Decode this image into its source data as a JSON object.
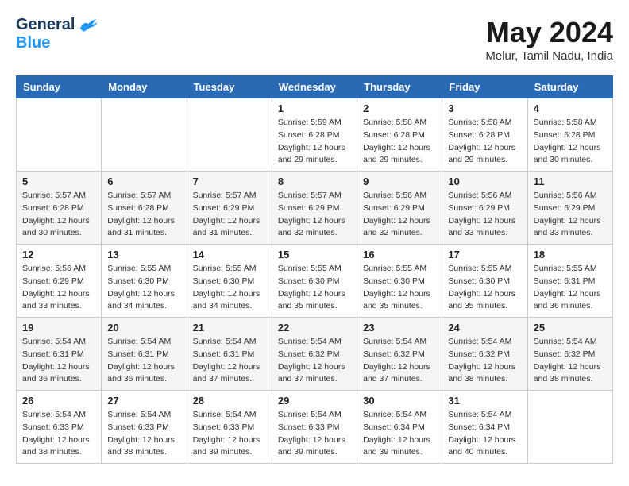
{
  "header": {
    "logo_general": "General",
    "logo_blue": "Blue",
    "month_title": "May 2024",
    "location": "Melur, Tamil Nadu, India"
  },
  "days_of_week": [
    "Sunday",
    "Monday",
    "Tuesday",
    "Wednesday",
    "Thursday",
    "Friday",
    "Saturday"
  ],
  "weeks": [
    [
      {
        "day": "",
        "info": ""
      },
      {
        "day": "",
        "info": ""
      },
      {
        "day": "",
        "info": ""
      },
      {
        "day": "1",
        "info": "Sunrise: 5:59 AM\nSunset: 6:28 PM\nDaylight: 12 hours\nand 29 minutes."
      },
      {
        "day": "2",
        "info": "Sunrise: 5:58 AM\nSunset: 6:28 PM\nDaylight: 12 hours\nand 29 minutes."
      },
      {
        "day": "3",
        "info": "Sunrise: 5:58 AM\nSunset: 6:28 PM\nDaylight: 12 hours\nand 29 minutes."
      },
      {
        "day": "4",
        "info": "Sunrise: 5:58 AM\nSunset: 6:28 PM\nDaylight: 12 hours\nand 30 minutes."
      }
    ],
    [
      {
        "day": "5",
        "info": "Sunrise: 5:57 AM\nSunset: 6:28 PM\nDaylight: 12 hours\nand 30 minutes."
      },
      {
        "day": "6",
        "info": "Sunrise: 5:57 AM\nSunset: 6:28 PM\nDaylight: 12 hours\nand 31 minutes."
      },
      {
        "day": "7",
        "info": "Sunrise: 5:57 AM\nSunset: 6:29 PM\nDaylight: 12 hours\nand 31 minutes."
      },
      {
        "day": "8",
        "info": "Sunrise: 5:57 AM\nSunset: 6:29 PM\nDaylight: 12 hours\nand 32 minutes."
      },
      {
        "day": "9",
        "info": "Sunrise: 5:56 AM\nSunset: 6:29 PM\nDaylight: 12 hours\nand 32 minutes."
      },
      {
        "day": "10",
        "info": "Sunrise: 5:56 AM\nSunset: 6:29 PM\nDaylight: 12 hours\nand 33 minutes."
      },
      {
        "day": "11",
        "info": "Sunrise: 5:56 AM\nSunset: 6:29 PM\nDaylight: 12 hours\nand 33 minutes."
      }
    ],
    [
      {
        "day": "12",
        "info": "Sunrise: 5:56 AM\nSunset: 6:29 PM\nDaylight: 12 hours\nand 33 minutes."
      },
      {
        "day": "13",
        "info": "Sunrise: 5:55 AM\nSunset: 6:30 PM\nDaylight: 12 hours\nand 34 minutes."
      },
      {
        "day": "14",
        "info": "Sunrise: 5:55 AM\nSunset: 6:30 PM\nDaylight: 12 hours\nand 34 minutes."
      },
      {
        "day": "15",
        "info": "Sunrise: 5:55 AM\nSunset: 6:30 PM\nDaylight: 12 hours\nand 35 minutes."
      },
      {
        "day": "16",
        "info": "Sunrise: 5:55 AM\nSunset: 6:30 PM\nDaylight: 12 hours\nand 35 minutes."
      },
      {
        "day": "17",
        "info": "Sunrise: 5:55 AM\nSunset: 6:30 PM\nDaylight: 12 hours\nand 35 minutes."
      },
      {
        "day": "18",
        "info": "Sunrise: 5:55 AM\nSunset: 6:31 PM\nDaylight: 12 hours\nand 36 minutes."
      }
    ],
    [
      {
        "day": "19",
        "info": "Sunrise: 5:54 AM\nSunset: 6:31 PM\nDaylight: 12 hours\nand 36 minutes."
      },
      {
        "day": "20",
        "info": "Sunrise: 5:54 AM\nSunset: 6:31 PM\nDaylight: 12 hours\nand 36 minutes."
      },
      {
        "day": "21",
        "info": "Sunrise: 5:54 AM\nSunset: 6:31 PM\nDaylight: 12 hours\nand 37 minutes."
      },
      {
        "day": "22",
        "info": "Sunrise: 5:54 AM\nSunset: 6:32 PM\nDaylight: 12 hours\nand 37 minutes."
      },
      {
        "day": "23",
        "info": "Sunrise: 5:54 AM\nSunset: 6:32 PM\nDaylight: 12 hours\nand 37 minutes."
      },
      {
        "day": "24",
        "info": "Sunrise: 5:54 AM\nSunset: 6:32 PM\nDaylight: 12 hours\nand 38 minutes."
      },
      {
        "day": "25",
        "info": "Sunrise: 5:54 AM\nSunset: 6:32 PM\nDaylight: 12 hours\nand 38 minutes."
      }
    ],
    [
      {
        "day": "26",
        "info": "Sunrise: 5:54 AM\nSunset: 6:33 PM\nDaylight: 12 hours\nand 38 minutes."
      },
      {
        "day": "27",
        "info": "Sunrise: 5:54 AM\nSunset: 6:33 PM\nDaylight: 12 hours\nand 38 minutes."
      },
      {
        "day": "28",
        "info": "Sunrise: 5:54 AM\nSunset: 6:33 PM\nDaylight: 12 hours\nand 39 minutes."
      },
      {
        "day": "29",
        "info": "Sunrise: 5:54 AM\nSunset: 6:33 PM\nDaylight: 12 hours\nand 39 minutes."
      },
      {
        "day": "30",
        "info": "Sunrise: 5:54 AM\nSunset: 6:34 PM\nDaylight: 12 hours\nand 39 minutes."
      },
      {
        "day": "31",
        "info": "Sunrise: 5:54 AM\nSunset: 6:34 PM\nDaylight: 12 hours\nand 40 minutes."
      },
      {
        "day": "",
        "info": ""
      }
    ]
  ]
}
